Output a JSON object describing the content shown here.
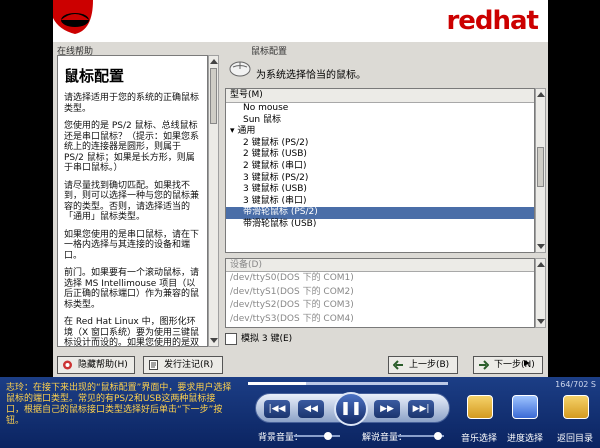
{
  "banner": {
    "brand": "redhat"
  },
  "help": {
    "section_label": "在线帮助",
    "title": "鼠标配置",
    "paragraphs": [
      "请选择适用于您的系统的正确鼠标类型。",
      "您使用的是 PS/2 鼠标、总线鼠标还是串口鼠标？（提示：如果您系统上的连接器是圆形，则属于 PS/2 鼠标；如果是长方形，则属于串口鼠标。）",
      "请尽量找到确切匹配。如果找不到，则可以选择一种与您的鼠标兼容的类型。否则，请选择适当的「通用」鼠标类型。",
      "如果您使用的是串口鼠标，请在下一格内选择与其连接的设备和端口。",
      "前门。如果要有一个滚动鼠标，请选择 MS Intellimouse 项目（以后正确的鼠标端口）作为兼容的鼠标类型。",
      "在 Red Hat Linux 中，图形化环境（X 窗口系统）要为使用三键鼠标设计而设的。如果您使用的是双键鼠标，"
    ]
  },
  "mouse": {
    "section_label": "鼠标配置",
    "heading": "为系统选择恰当的鼠标。",
    "model_header": "型号(M)",
    "models": [
      {
        "label": "No mouse",
        "level": 1
      },
      {
        "label": "Sun 鼠标",
        "level": 1
      },
      {
        "label": "▾ 通用",
        "level": 0
      },
      {
        "label": "2 键鼠标 (PS/2)",
        "level": 1
      },
      {
        "label": "2 键鼠标 (USB)",
        "level": 1
      },
      {
        "label": "2 键鼠标 (串口)",
        "level": 1
      },
      {
        "label": "3 键鼠标 (PS/2)",
        "level": 1
      },
      {
        "label": "3 键鼠标 (USB)",
        "level": 1
      },
      {
        "label": "3 键鼠标 (串口)",
        "level": 1
      },
      {
        "label": "带滑轮鼠标 (PS/2)",
        "level": 1,
        "selected": true
      },
      {
        "label": "带滑轮鼠标 (USB)",
        "level": 1
      }
    ],
    "device_header": "设备(D)",
    "devices": [
      "/dev/ttyS0(DOS 下的 COM1)",
      "/dev/ttyS1(DOS 下的 COM2)",
      "/dev/ttyS2(DOS 下的 COM3)",
      "/dev/ttyS3(DOS 下的 COM4)"
    ],
    "emulate_label": "模拟 3 键(E)"
  },
  "buttons": {
    "hide_help": "隐藏帮助(H)",
    "release_notes": "发行注记(R)",
    "back": "上一步(B)",
    "next": "下一步(N)"
  },
  "player": {
    "tip": "志玲：在接下来出现的“鼠标配置”界面中，要求用户选择鼠标的端口类型。常见的有PS/2和USB这两种鼠标接口，根据自己的鼠标接口类型选择好后单击“下一步”按钮。",
    "time": "164/702 S",
    "bg_volume_label": "背景音量：",
    "fg_volume_label": "解说音量：",
    "progress": 0.29,
    "tools": {
      "music": "音乐选择",
      "progress": "进度选择",
      "menu": "返回目录"
    },
    "controls": {
      "prev": "|◀◀",
      "rewind": "◀◀",
      "pause": "❚❚",
      "forward": "▶▶",
      "next": "▶▶|"
    }
  },
  "colors": {
    "brand_red": "#cc0000",
    "selection": "#4a6ea8",
    "player_bg": "#1c3e86",
    "tip_text": "#ffd24d"
  }
}
